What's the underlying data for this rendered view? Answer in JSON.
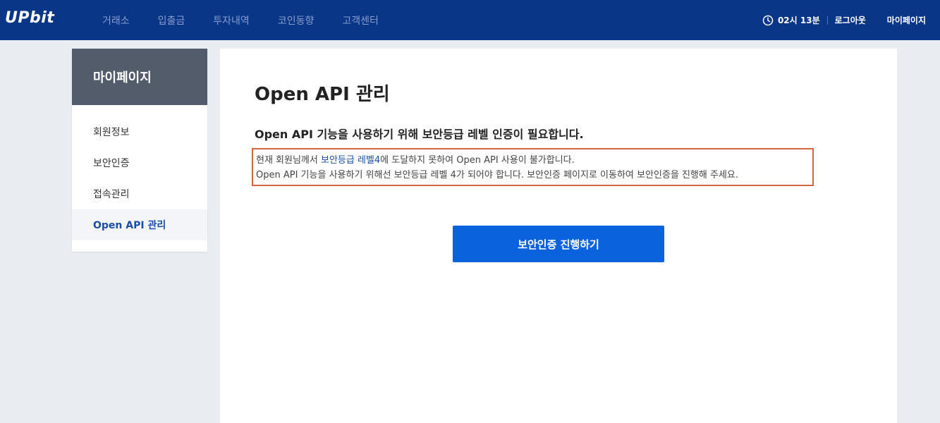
{
  "header": {
    "logo": "UPbit",
    "nav": [
      "거래소",
      "입출금",
      "투자내역",
      "코인동향",
      "고객센터"
    ],
    "session_time": "02시 13분",
    "logout": "로그아웃",
    "mypage": "마이페이지",
    "icons": {
      "clock": "clock-icon"
    }
  },
  "sidebar": {
    "title": "마이페이지",
    "items": [
      {
        "label": "회원정보",
        "active": false
      },
      {
        "label": "보안인증",
        "active": false
      },
      {
        "label": "접속관리",
        "active": false
      },
      {
        "label": "Open API 관리",
        "active": true
      }
    ]
  },
  "main": {
    "title": "Open API 관리",
    "subtitle": "Open API 기능을 사용하기 위해 보안등급 레벨 인증이 필요합니다.",
    "notice": {
      "line1_prefix": "현재 회원님께서 ",
      "line1_highlight": "보안등급 레벨4",
      "line1_suffix": "에 도달하지 못하여 Open API 사용이 불가합니다.",
      "line2": "Open API 기능을 사용하기 위해선 보안등급 레벨 4가 되어야 합니다. 보안인증 페이지로 이동하여 보안인증을 진행해 주세요."
    },
    "action_button": "보안인증 진행하기"
  },
  "colors": {
    "header_bg": "#093687",
    "accent_blue": "#0b62dd",
    "highlight_text": "#1a4ea6",
    "notice_border": "#d2663f",
    "sidebar_header_bg": "#525c6b"
  }
}
